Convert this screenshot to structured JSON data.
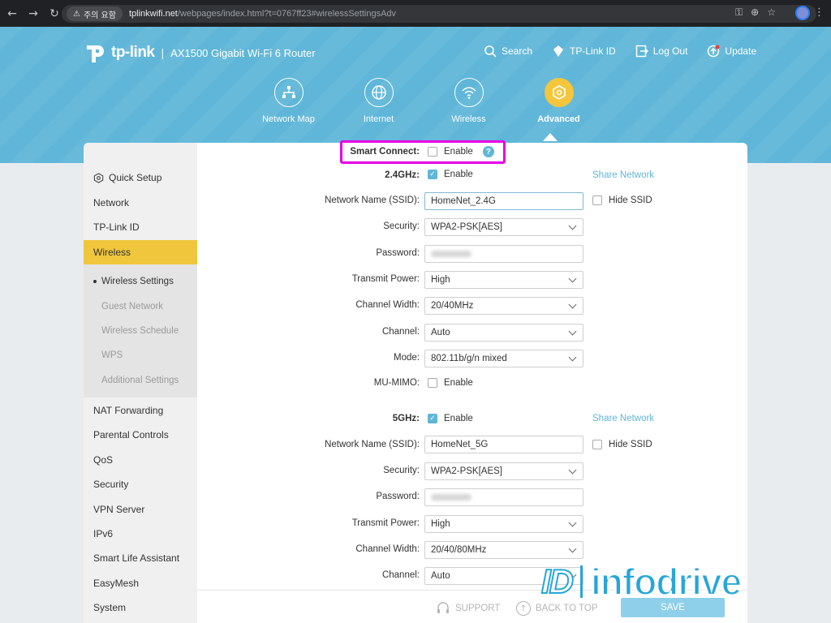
{
  "browser": {
    "security_chip": "주의 요함",
    "url_host": "tplinkwifi.net",
    "url_rest": "/webpages/index.html?t=0767ff23#wirelessSettingsAdv"
  },
  "header": {
    "brand": "tp-link",
    "product": "AX1500 Gigabit Wi-Fi 6 Router",
    "links": {
      "search": "Search",
      "tplink_id": "TP-Link ID",
      "logout": "Log Out",
      "update": "Update"
    },
    "tabs": {
      "network_map": "Network Map",
      "internet": "Internet",
      "wireless": "Wireless",
      "advanced": "Advanced"
    }
  },
  "sidebar": {
    "quick_setup": "Quick Setup",
    "network": "Network",
    "tplink_id": "TP-Link ID",
    "wireless": "Wireless",
    "wireless_settings": "Wireless Settings",
    "guest_network": "Guest Network",
    "wireless_schedule": "Wireless Schedule",
    "wps": "WPS",
    "additional_settings": "Additional Settings",
    "nat_forwarding": "NAT Forwarding",
    "parental_controls": "Parental Controls",
    "qos": "QoS",
    "security": "Security",
    "vpn_server": "VPN Server",
    "ipv6": "IPv6",
    "smart_life": "Smart Life Assistant",
    "easymesh": "EasyMesh",
    "system": "System"
  },
  "form": {
    "smart_connect_label": "Smart Connect:",
    "enable": "Enable",
    "share_network": "Share Network",
    "hide_ssid": "Hide SSID",
    "labels": {
      "ssid": "Network Name (SSID):",
      "security": "Security:",
      "password": "Password:",
      "transmit_power": "Transmit Power:",
      "channel_width": "Channel Width:",
      "channel": "Channel:",
      "mode": "Mode:",
      "mu_mimo": "MU-MIMO:"
    },
    "band24": {
      "label": "2.4GHz:",
      "ssid": "HomeNet_2.4G",
      "security": "WPA2-PSK[AES]",
      "transmit_power": "High",
      "channel_width": "20/40MHz",
      "channel": "Auto",
      "mode": "802.11b/g/n mixed"
    },
    "band5": {
      "label": "5GHz:",
      "ssid": "HomeNet_5G",
      "security": "WPA2-PSK[AES]",
      "transmit_power": "High",
      "channel_width": "20/40/80MHz",
      "channel": "Auto"
    }
  },
  "footer": {
    "support": "SUPPORT",
    "back_to_top": "BACK TO TOP",
    "save": "SAVE"
  },
  "watermark": {
    "mark": "ID",
    "text": "infodrive"
  },
  "colors": {
    "brand_blue": "#5fb6d8",
    "active_yellow": "#f0c63c",
    "highlight_magenta": "#e600e6",
    "watermark_blue": "#27a6d8"
  }
}
